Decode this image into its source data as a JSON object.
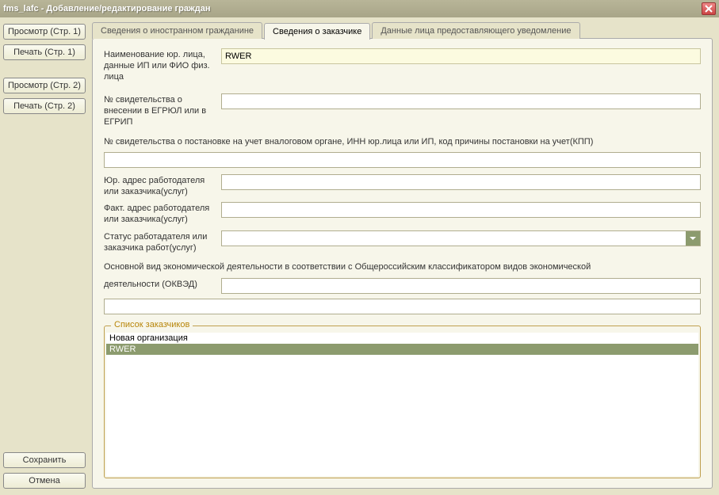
{
  "window": {
    "title": "fms_lafc - Добавление/редактирование граждан"
  },
  "sidebar": {
    "view1": "Просмотр (Стр. 1)",
    "print1": "Печать (Стр. 1)",
    "view2": "Просмотр (Стр. 2)",
    "print2": "Печать (Стр. 2)",
    "save": "Сохранить",
    "cancel": "Отмена"
  },
  "tabs": {
    "t1": "Сведения о иностранном гражданине",
    "t2": "Сведения о заказчике",
    "t3": "Данные лица предоставляющего уведомление"
  },
  "form": {
    "name_label": "Наименование юр. лица, данные ИП или ФИО физ. лица",
    "name_value": "RWER",
    "reg_label": "№ свидетельства о внесении в ЕГРЮЛ или в ЕГРИП",
    "reg_value": "",
    "tax_text": "№ свидетельства о постановке на учет вналоговом органе, ИНН юр.лица или ИП, код причины постановки на учет(КПП)",
    "tax_value": "",
    "legal_addr_label": "Юр. адрес работодателя или заказчика(услуг)",
    "legal_addr_value": "",
    "fact_addr_label": "Факт. адрес работодателя или заказчика(услуг)",
    "fact_addr_value": "",
    "status_label": "Статус работадателя или заказчика работ(услуг)",
    "status_value": "",
    "okved_text": "Основной вид экономической деятельности в соответствии с Общероссийским классификатором видов экономической",
    "okved_label": "деятельности (ОКВЭД)",
    "okved_value": "",
    "okved_full_value": ""
  },
  "customers": {
    "title": "Список заказчиков",
    "items": [
      "Новая организация",
      "RWER"
    ],
    "selected_index": 1
  }
}
